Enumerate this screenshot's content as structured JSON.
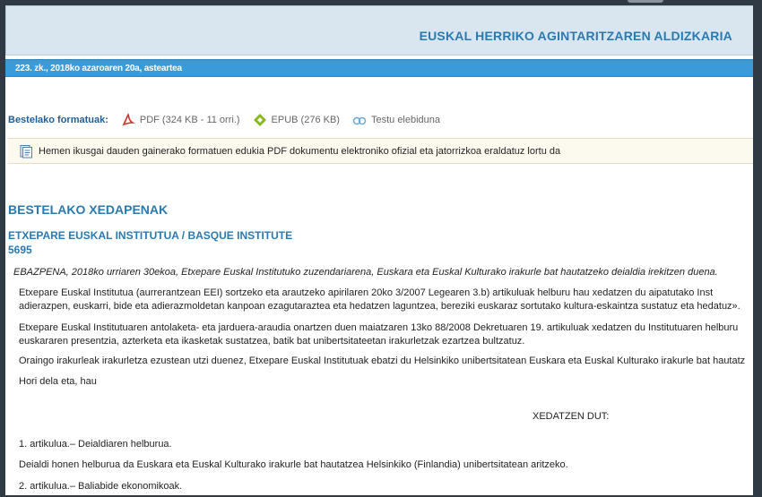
{
  "header": {
    "title": "EUSKAL HERRIKO AGINTARITZAREN ALDIZKARIA"
  },
  "issue": {
    "text": "223. zk., 2018ko azaroaren 20a, asteartea"
  },
  "formats": {
    "label": "Bestelako formatuak:",
    "pdf": {
      "label": "PDF (324 KB - 11 orri.)",
      "icon": "pdf-icon"
    },
    "epub": {
      "label": "EPUB (276 KB)",
      "icon": "epub-icon"
    },
    "text": {
      "label": "Testu elebiduna",
      "icon": "bilingual-text-icon"
    }
  },
  "notice": {
    "text": "Hemen ikusgai dauden gainerako formatuen edukia PDF dokumentu elektroniko ofizial eta jatorrizkoa eraldatuz lortu da",
    "icon": "document-icon"
  },
  "section": {
    "title": "BESTELAKO XEDAPENAK"
  },
  "institution": {
    "name": "ETXEPARE EUSKAL INSTITUTUA / BASQUE INSTITUTE",
    "number": "5695"
  },
  "body": {
    "summary": "EBAZPENA, 2018ko urriaren 30ekoa, Etxepare Euskal Institutuko zuzendariarena, Euskara eta Euskal Kulturako irakurle bat hautatzeko deialdia irekitzen duena.",
    "p1_line1": "Etxepare Euskal Institutua (aurrerantzean EEI) sortzeko eta arautzeko apirilaren 20ko 3/2007 Legearen 3.b) artikuluak helburu hau xedatzen du aipatutako Inst",
    "p1_line2": "adierazpen, euskarri, bide eta adierazmoldetan kanpoan ezagutaraztea eta hedatzen laguntzea, bereziki euskaraz sortutako kultura-eskaintza sustatuz eta hedatuz».",
    "p2_line1": "Etxepare Euskal Institutuaren antolaketa- eta jarduera-araudia onartzen duen maiatzaren 13ko 88/2008 Dekretuaren 19. artikuluak xedatzen du Institutuaren helburu",
    "p2_line2": "euskararen presentzia, azterketa eta ikasketak sustatzea, batik bat unibertsitateetan irakurletzak ezartzea bultzatuz.",
    "p3": "Oraingo irakurleak irakurletza ezustean utzi duenez, Etxepare Euskal Institutuak ebatzi du Helsinkiko unibertsitatean Euskara eta Euskal Kulturako irakurle bat hautatz",
    "p4": "Hori dela eta, hau",
    "decree": "XEDATZEN DUT:",
    "art1_title": "1. artikulua.– Deialdiaren helburua.",
    "art1_text": "Deialdi honen helburua da Euskara eta Euskal Kulturako irakurle bat hautatzea Helsinkiko (Finlandia) unibertsitatean aritzeko.",
    "art2_title": "2. artikulua.– Baliabide ekonomikoak."
  }
}
